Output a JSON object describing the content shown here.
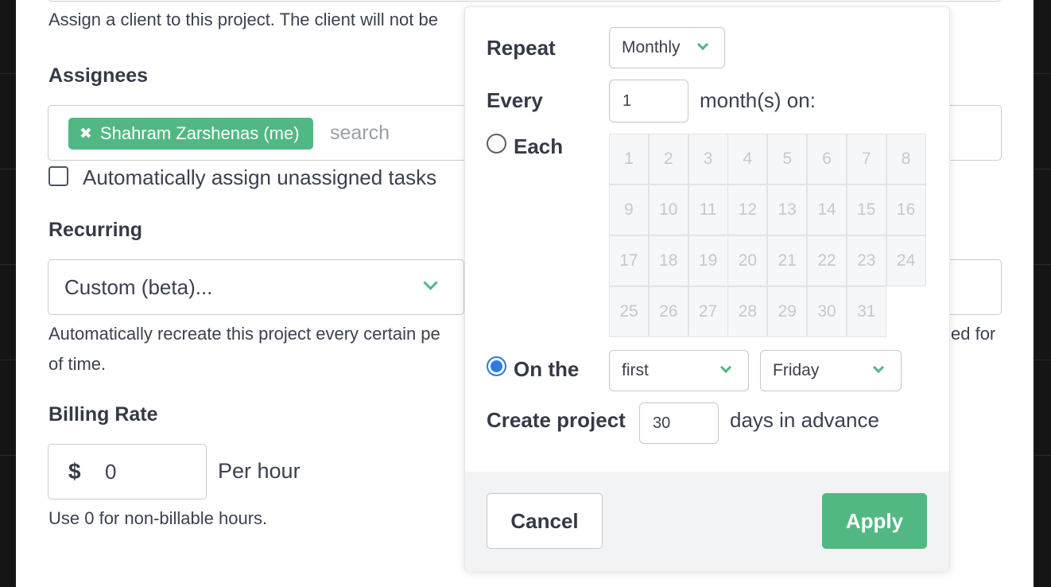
{
  "client": {
    "help_text": "Assign a client to this project. The client will not be"
  },
  "assignees": {
    "label": "Assignees",
    "tag_label": "Shahram Zarshenas (me)",
    "search_placeholder": "search",
    "auto_assign_label": "Automatically assign unassigned tasks"
  },
  "recurring": {
    "label": "Recurring",
    "selected": "Custom (beta)...",
    "help_line1_left": "Automatically recreate this project every certain pe",
    "help_line1_right": "ed for",
    "help_line2": "of time."
  },
  "billing": {
    "label": "Billing Rate",
    "currency": "$",
    "value": "0",
    "unit": "Per hour",
    "help_text": "Use 0 for non-billable hours."
  },
  "popup": {
    "repeat_label": "Repeat",
    "repeat_value": "Monthly",
    "every_label": "Every",
    "every_value": "1",
    "every_unit": "month(s) on:",
    "each_label": "Each",
    "each_selected": false,
    "days": [
      "1",
      "2",
      "3",
      "4",
      "5",
      "6",
      "7",
      "8",
      "9",
      "10",
      "11",
      "12",
      "13",
      "14",
      "15",
      "16",
      "17",
      "18",
      "19",
      "20",
      "21",
      "22",
      "23",
      "24",
      "25",
      "26",
      "27",
      "28",
      "29",
      "30",
      "31"
    ],
    "on_the_label": "On the",
    "on_the_selected": true,
    "ordinal_value": "first",
    "weekday_value": "Friday",
    "create_label": "Create project",
    "advance_value": "30",
    "advance_unit": "days in advance",
    "cancel_label": "Cancel",
    "apply_label": "Apply"
  },
  "colors": {
    "accent_green": "#52b883",
    "radio_blue": "#2c7be5"
  }
}
